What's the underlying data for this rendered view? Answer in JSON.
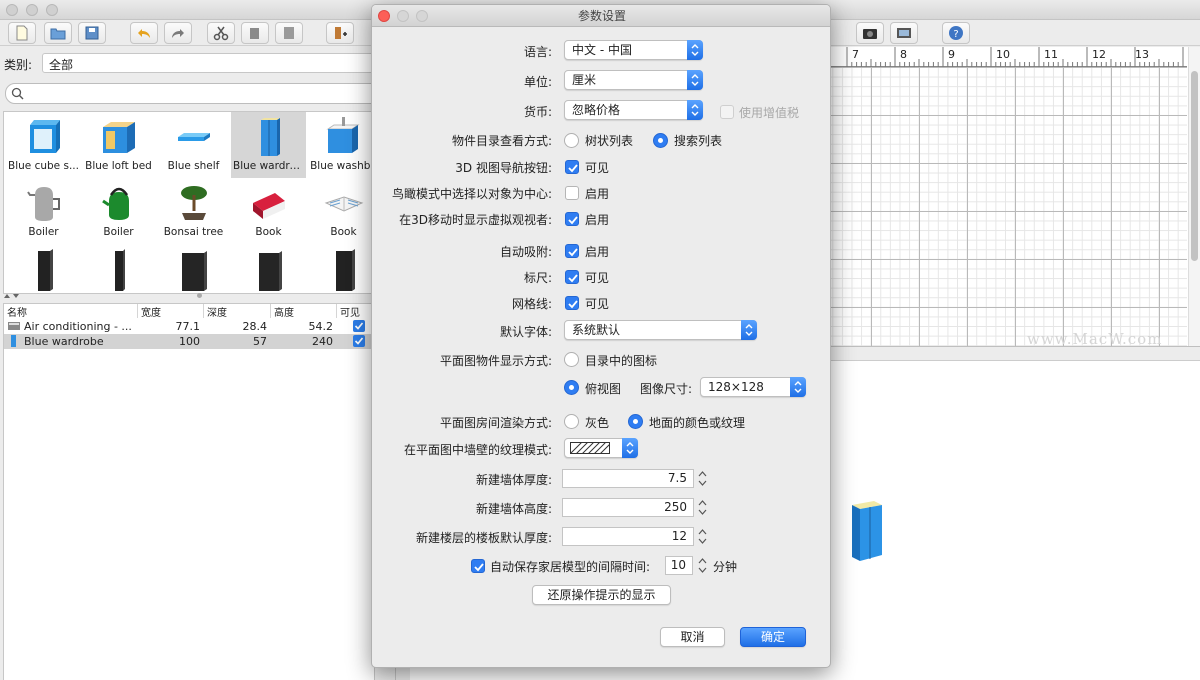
{
  "left_panel": {
    "category_label": "类别:",
    "category_value": "全部",
    "search_placeholder": "",
    "catalog_items": [
      {
        "label": "Blue cube s...",
        "icon": "blue-cube-shelf-icon",
        "selected": false
      },
      {
        "label": "Blue loft bed",
        "icon": "loft-bed-icon",
        "selected": false
      },
      {
        "label": "Blue shelf",
        "icon": "shelf-icon",
        "selected": false
      },
      {
        "label": "Blue wardro...",
        "icon": "wardrobe-icon",
        "selected": true
      },
      {
        "label": "Blue washba",
        "icon": "washbasin-icon",
        "selected": false
      },
      {
        "label": "Boiler",
        "icon": "boiler-icon",
        "selected": false
      },
      {
        "label": "Boiler",
        "icon": "kettle-icon",
        "selected": false
      },
      {
        "label": "Bonsai tree",
        "icon": "bonsai-icon",
        "selected": false
      },
      {
        "label": "Book",
        "icon": "book-icon",
        "selected": false
      },
      {
        "label": "Book",
        "icon": "open-book-icon",
        "selected": false
      }
    ],
    "table": {
      "headers": [
        "名称",
        "宽度",
        "深度",
        "高度",
        "可见"
      ],
      "rows": [
        {
          "name": "Air conditioning - ...",
          "width": "77.1",
          "depth": "28.4",
          "height": "54.2",
          "visible": true,
          "selected": false
        },
        {
          "name": "Blue wardrobe",
          "width": "100",
          "depth": "57",
          "height": "240",
          "visible": true,
          "selected": true
        }
      ]
    }
  },
  "plan": {
    "ruler_labels": [
      "7",
      "8",
      "9",
      "10",
      "11",
      "12",
      "13"
    ],
    "watermark": "www.MacW.com"
  },
  "dialog": {
    "title": "参数设置",
    "language": {
      "label": "语言:",
      "value": "中文 - 中国"
    },
    "unit": {
      "label": "单位:",
      "value": "厘米"
    },
    "currency": {
      "label": "货币:",
      "value": "忽略价格",
      "vat_label": "使用增值税",
      "vat_checked": false,
      "vat_enabled": false
    },
    "catalog_view": {
      "label": "物件目录查看方式:",
      "options": [
        "树状列表",
        "搜索列表"
      ],
      "selected": 1
    },
    "nav_buttons": {
      "label": "3D 视图导航按钮:",
      "option": "可见",
      "checked": true
    },
    "aerial_center": {
      "label": "鸟瞰模式中选择以对象为中心:",
      "option": "启用",
      "checked": false
    },
    "virtual_visitor": {
      "label": "在3D移动时显示虚拟观视者:",
      "option": "启用",
      "checked": true
    },
    "magnetism": {
      "label": "自动吸附:",
      "option": "启用",
      "checked": true
    },
    "rulers": {
      "label": "标尺:",
      "option": "可见",
      "checked": true
    },
    "grid": {
      "label": "网格线:",
      "option": "可见",
      "checked": true
    },
    "default_font": {
      "label": "默认字体:",
      "value": "系统默认"
    },
    "furniture_icon": {
      "label": "平面图物件显示方式:",
      "options": [
        "目录中的图标",
        "俯视图"
      ],
      "selected": 1,
      "size_label": "图像尺寸:",
      "size_value": "128×128"
    },
    "room_render": {
      "label": "平面图房间渲染方式:",
      "options": [
        "灰色",
        "地面的颜色或纹理"
      ],
      "selected": 1
    },
    "wall_pattern": {
      "label": "在平面图中墙壁的纹理模式:"
    },
    "wall_thickness": {
      "label": "新建墙体厚度:",
      "value": "7.5"
    },
    "wall_height": {
      "label": "新建墙体高度:",
      "value": "250"
    },
    "floor_thickness": {
      "label": "新建楼层的楼板默认厚度:",
      "value": "12"
    },
    "autosave": {
      "label": "自动保存家居模型的间隔时间:",
      "value": "10",
      "unit": "分钟",
      "checked": true
    },
    "reset_tips": "还原操作提示的显示",
    "cancel": "取消",
    "ok": "确定"
  },
  "colors": {
    "accent": "#2f7df2",
    "wardrobe": "#2f8fe0"
  }
}
